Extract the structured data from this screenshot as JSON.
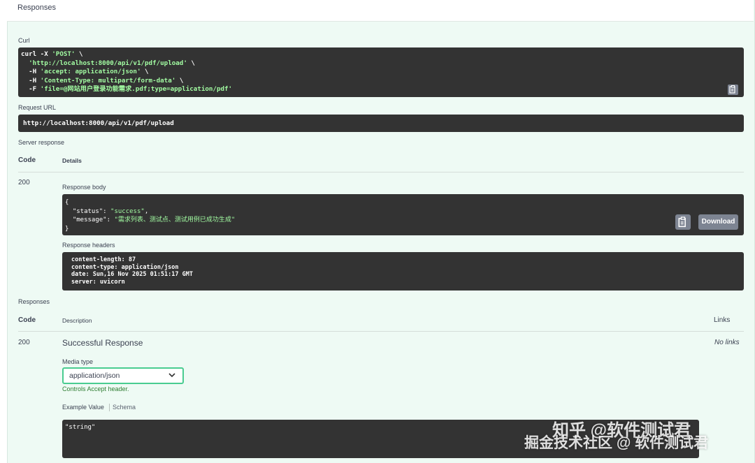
{
  "responses_header": "Responses",
  "curl": {
    "label": "Curl",
    "lines": [
      {
        "plain": "curl -X ",
        "str": "'POST'",
        "tail": " \\"
      },
      {
        "plain": "  ",
        "str": "'http://localhost:8000/api/v1/pdf/upload'",
        "tail": " \\"
      },
      {
        "plain": "  -H ",
        "str": "'accept: application/json'",
        "tail": " \\"
      },
      {
        "plain": "  -H ",
        "str": "'Content-Type: multipart/form-data'",
        "tail": " \\"
      },
      {
        "plain": "  -F ",
        "str": "'file=@网站用户登录功能需求.pdf;type=application/pdf'",
        "tail": ""
      }
    ]
  },
  "request_url": {
    "label": "Request URL",
    "value": "http://localhost:8000/api/v1/pdf/upload"
  },
  "server_response": {
    "label": "Server response",
    "code_header": "Code",
    "details_header": "Details",
    "code": "200",
    "body_label": "Response body",
    "body_lines": [
      {
        "a": "{",
        "b": "",
        "c": ""
      },
      {
        "a": "  \"status\": ",
        "b": "\"success\"",
        "c": ","
      },
      {
        "a": "  \"message\": ",
        "b": "\"需求列表、测试点、测试用例已成功生成\"",
        "c": ""
      },
      {
        "a": "}",
        "b": "",
        "c": ""
      }
    ],
    "download_label": "Download",
    "headers_label": "Response headers",
    "headers_lines": [
      "content-length: 87",
      "content-type: application/json",
      "date: Sun,16 Nov 2025 01:51:17 GMT",
      "server: uvicorn"
    ]
  },
  "responses": {
    "label": "Responses",
    "code_header": "Code",
    "description_header": "Description",
    "links_header": "Links",
    "code": "200",
    "description": "Successful Response",
    "links_value": "No links",
    "media_type_label": "Media type",
    "media_type_value": "application/json",
    "controls_note": "Controls Accept header.",
    "example_value_tab": "Example Value",
    "schema_tab": "Schema",
    "example_value": "\"string\""
  },
  "watermark": {
    "line1": "知乎 @软件测试君",
    "line2": "掘金技术社区 @ 软件测试君"
  },
  "colors": {
    "panel_bg": "#eefaf4",
    "code_bg": "#333333",
    "string_green": "#a2fca2",
    "select_border": "#49cc90",
    "button_gray": "#7d8492"
  }
}
